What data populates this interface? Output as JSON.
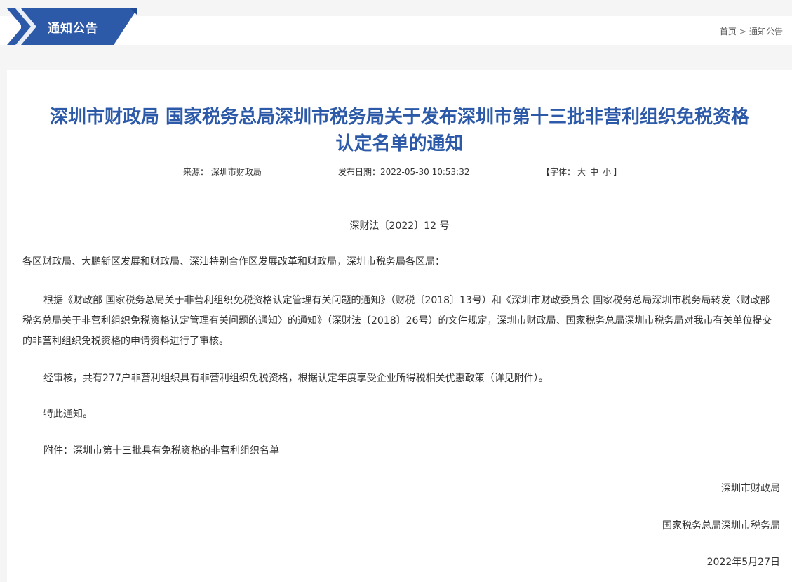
{
  "header": {
    "section_title": "通知公告",
    "breadcrumb": {
      "home": "首页",
      "separator": ">",
      "current": "通知公告"
    },
    "accent_color": "#2c5aa8"
  },
  "article": {
    "title_line1": "深圳市财政局 国家税务总局深圳市税务局关于发布深圳市第十三批非营利组织免税资格",
    "title_line2": "认定名单的通知",
    "meta": {
      "source_label": "来源：",
      "source": "深圳市财政局",
      "date_label": "发布日期：",
      "date": "2022-05-30 10:53:32",
      "font_label": "【字体：",
      "font_large": "大",
      "font_medium": "中",
      "font_small": "小",
      "font_close": "】"
    },
    "doc_number": "深财法〔2022〕12 号",
    "addressee": "各区财政局、大鹏新区发展和财政局、深汕特别合作区发展改革和财政局，深圳市税务局各区局：",
    "para1": "根据《财政部 国家税务总局关于非营利组织免税资格认定管理有关问题的通知》（财税〔2018〕13号）和《深圳市财政委员会 国家税务总局深圳市税务局转发〈财政部 税务总局关于非营利组织免税资格认定管理有关问题的通知〉的通知》（深财法〔2018〕26号）的文件规定，深圳市财政局、国家税务总局深圳市税务局对我市有关单位提交的非营利组织免税资格的申请资料进行了审核。",
    "para2": "经审核，共有277户非营利组织具有非营利组织免税资格，根据认定年度享受企业所得税相关优惠政策（详见附件）。",
    "para3": "特此通知。",
    "attachment_label": "附件：",
    "attachment_link": "深圳市第十三批具有免税资格的非营利组织名单",
    "signature1": "深圳市财政局",
    "signature2": "国家税务总局深圳市税务局",
    "sign_date": "2022年5月27日"
  }
}
